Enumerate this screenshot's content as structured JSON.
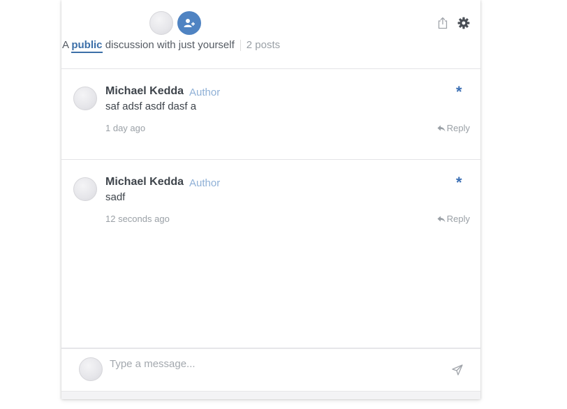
{
  "header": {
    "subtitle": {
      "prefix": "A",
      "visibility": "public",
      "suffix": "discussion with just yourself",
      "post_count": "2 posts"
    }
  },
  "posts": [
    {
      "author": "Michael Kedda",
      "badge": "Author",
      "message": "saf adsf asdf dasf a",
      "timestamp": "1 day ago",
      "reply_label": "Reply",
      "star": "*"
    },
    {
      "author": "Michael Kedda",
      "badge": "Author",
      "message": "sadf",
      "timestamp": "12 seconds ago",
      "reply_label": "Reply",
      "star": "*"
    }
  ],
  "composer": {
    "placeholder": "Type a message..."
  },
  "colors": {
    "accent": "#4f83c2",
    "link": "#3c6fa8",
    "badge": "#8fb0d6",
    "muted": "#9aa0a6"
  },
  "icons": {
    "add_user": "add-user-icon",
    "share": "share-icon",
    "settings": "gear-icon",
    "star": "asterisk-icon",
    "reply": "reply-arrow-icon",
    "send": "send-icon"
  }
}
